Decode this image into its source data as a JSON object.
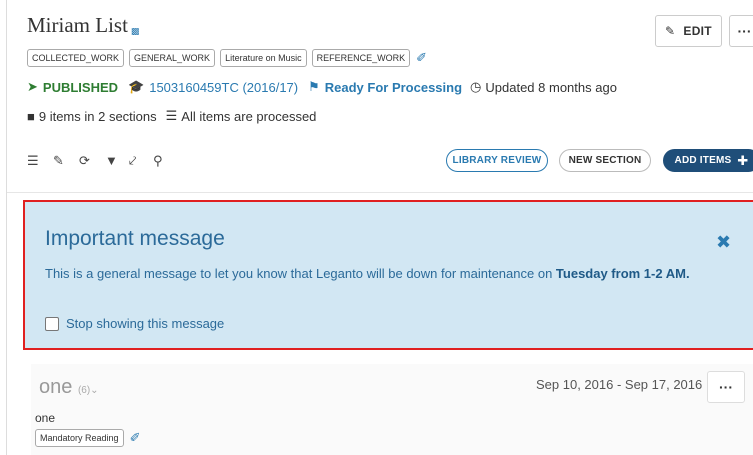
{
  "header": {
    "title": "Miriam List",
    "edit_label": "EDIT",
    "more_label": "···"
  },
  "tags": [
    "COLLECTED_WORK",
    "GENERAL_WORK",
    "Literature on Music",
    "REFERENCE_WORK"
  ],
  "status": {
    "published": "PUBLISHED",
    "course": "1503160459TC (2016/17)",
    "processing": "Ready For Processing",
    "updated": "Updated 8 months ago"
  },
  "items_info": {
    "count": "9 items in 2 sections",
    "processed": "All items are processed"
  },
  "toolbar": {
    "library_review": "LIBRARY REVIEW",
    "new_section": "NEW SECTION",
    "add_items": "ADD ITEMS"
  },
  "message": {
    "title": "Important message",
    "body_prefix": "This is a general message to let you know that Leganto will be down for maintenance on ",
    "body_bold": "Tuesday from 1-2 AM.",
    "stop_label": "Stop showing this message"
  },
  "section": {
    "name": "one",
    "count": "(6)",
    "dates": "Sep 10, 2016 - Sep 17, 2016",
    "description": "one",
    "tag": "Mandatory Reading",
    "more_label": "···"
  },
  "colors": {
    "accent": "#2a7ab0",
    "published": "#2e7d32",
    "add_items_bg": "#1f4e79",
    "message_bg": "#d2e7f3",
    "highlight_border": "#e02020"
  }
}
